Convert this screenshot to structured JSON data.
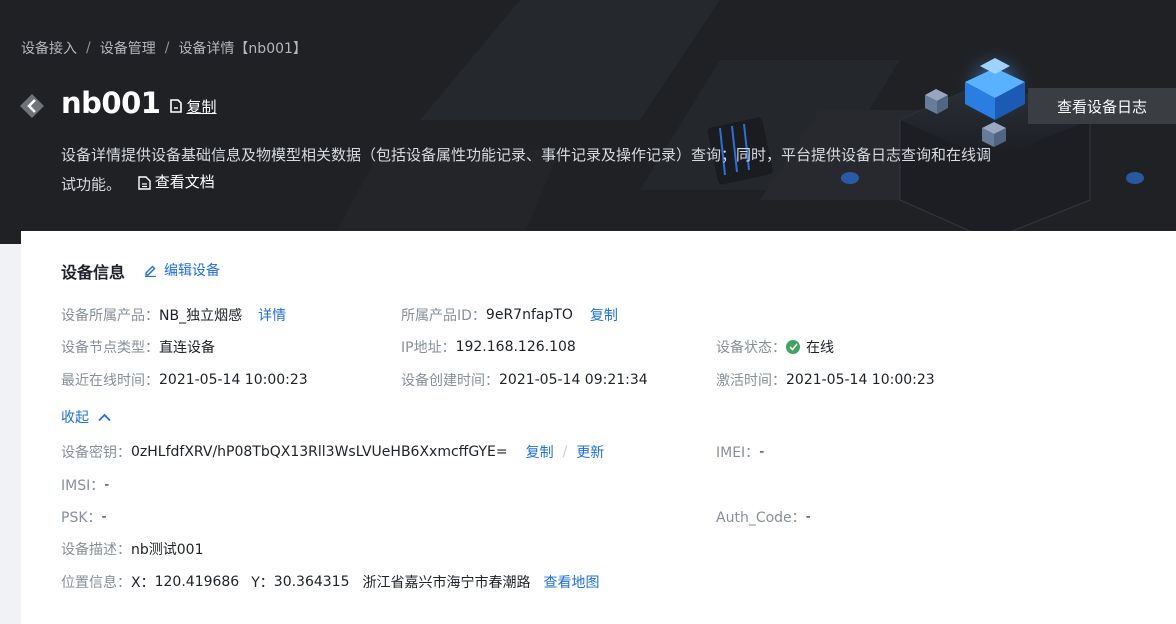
{
  "breadcrumb": {
    "items": [
      "设备接入",
      "设备管理",
      "设备详情【nb001】"
    ],
    "separator": "/"
  },
  "header": {
    "title": "nb001",
    "copy_label": "复制",
    "description": "设备详情提供设备基础信息及物模型相关数据（包括设备属性功能记录、事件记录及操作记录）查询；同时，平台提供设备日志查询和在线调试功能。",
    "doc_link": "查看文档",
    "log_button": "查看设备日志"
  },
  "device_info": {
    "title": "设备信息",
    "edit_label": "编辑设备",
    "product": {
      "label": "设备所属产品：",
      "value": "NB_独立烟感",
      "link": "详情"
    },
    "product_id": {
      "label": "所属产品ID：",
      "value": "9eR7nfapTO",
      "link": "复制"
    },
    "node_type": {
      "label": "设备节点类型：",
      "value": "直连设备"
    },
    "ip": {
      "label": "IP地址：",
      "value": "192.168.126.108"
    },
    "status": {
      "label": "设备状态：",
      "value": "在线",
      "color": "#3fa45e"
    },
    "last_online": {
      "label": "最近在线时间：",
      "value": "2021-05-14 10:00:23"
    },
    "created": {
      "label": "设备创建时间：",
      "value": "2021-05-14 09:21:34"
    },
    "activated": {
      "label": "激活时间：",
      "value": "2021-05-14 10:00:23"
    },
    "collapse_label": "收起",
    "secret": {
      "label": "设备密钥：",
      "value": "0zHLfdfXRV/hP08TbQX13Rll3WsLVUeHB6XxmcffGYE=",
      "copy": "复制",
      "separator": "/",
      "update": "更新"
    },
    "imei": {
      "label": "IMEI：",
      "value": "-"
    },
    "imsi": {
      "label": "IMSI：",
      "value": "-"
    },
    "psk": {
      "label": "PSK：",
      "value": "-"
    },
    "auth_code": {
      "label": "Auth_Code：",
      "value": "-"
    },
    "desc": {
      "label": "设备描述：",
      "value": "nb测试001"
    },
    "location": {
      "label": "位置信息：",
      "x_label": "X：",
      "x_value": "120.419686",
      "y_label": "Y：",
      "y_value": "30.364315",
      "address": "浙江省嘉兴市海宁市春潮路",
      "map_link": "查看地图"
    }
  },
  "colors": {
    "accent": "#1f6fde",
    "hero_bg": "#1f2125",
    "online": "#3fa45e"
  }
}
